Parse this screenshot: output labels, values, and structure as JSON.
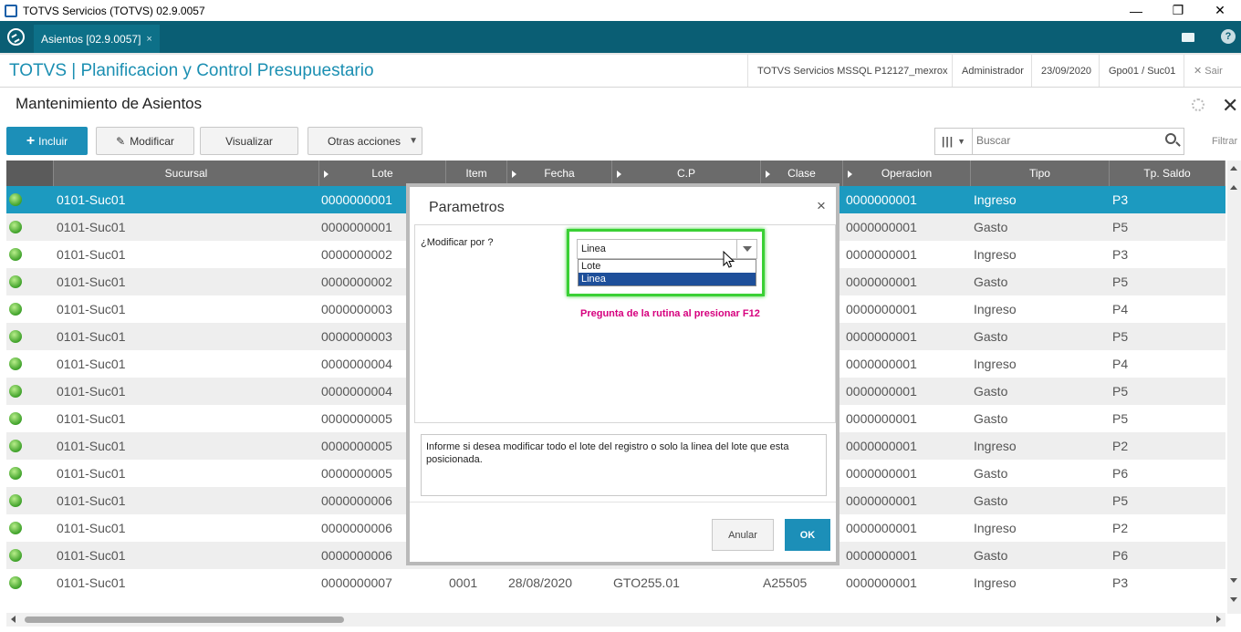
{
  "window": {
    "title": "TOTVS Servicios (TOTVS) 02.9.0057",
    "minimize": "—",
    "restore": "❐",
    "close": "✕"
  },
  "tabbar": {
    "tab_label": "Asientos [02.9.0057]",
    "tab_close": "×",
    "help": "?"
  },
  "header": {
    "module_title": "TOTVS | Planificacion y Control Presupuestario",
    "environment": "TOTVS Servicios MSSQL P12127_mexrox",
    "user": "Administrador",
    "date": "23/09/2020",
    "branch": "Gpo01 / Suc01",
    "exit": "✕  Sair"
  },
  "page": {
    "title": "Mantenimiento de Asientos",
    "close": "✕"
  },
  "toolbar": {
    "incluir": "Incluir",
    "modificar": "Modificar",
    "visualizar": "Visualizar",
    "otras_acciones": "Otras acciones",
    "search_placeholder": "Buscar",
    "filtrar": "Filtrar"
  },
  "grid": {
    "columns": [
      "Sucursal",
      "Lote",
      "Item",
      "Fecha",
      "C.P",
      "Clase",
      "Operacion",
      "Tipo",
      "Tp. Saldo"
    ],
    "rows": [
      {
        "sucursal": "0101-Suc01",
        "lote": "0000000001",
        "item": "",
        "fecha": "",
        "cp": "",
        "clase": "",
        "operacion": "0000000001",
        "tipo": "Ingreso",
        "tp_saldo": "P3"
      },
      {
        "sucursal": "0101-Suc01",
        "lote": "0000000001",
        "item": "",
        "fecha": "",
        "cp": "",
        "clase": "",
        "operacion": "0000000001",
        "tipo": "Gasto",
        "tp_saldo": "P5"
      },
      {
        "sucursal": "0101-Suc01",
        "lote": "0000000002",
        "item": "",
        "fecha": "",
        "cp": "",
        "clase": "",
        "operacion": "0000000001",
        "tipo": "Ingreso",
        "tp_saldo": "P3"
      },
      {
        "sucursal": "0101-Suc01",
        "lote": "0000000002",
        "item": "",
        "fecha": "",
        "cp": "",
        "clase": "",
        "operacion": "0000000001",
        "tipo": "Gasto",
        "tp_saldo": "P5"
      },
      {
        "sucursal": "0101-Suc01",
        "lote": "0000000003",
        "item": "",
        "fecha": "",
        "cp": "",
        "clase": "",
        "operacion": "0000000001",
        "tipo": "Ingreso",
        "tp_saldo": "P4"
      },
      {
        "sucursal": "0101-Suc01",
        "lote": "0000000003",
        "item": "",
        "fecha": "",
        "cp": "",
        "clase": "",
        "operacion": "0000000001",
        "tipo": "Gasto",
        "tp_saldo": "P5"
      },
      {
        "sucursal": "0101-Suc01",
        "lote": "0000000004",
        "item": "",
        "fecha": "",
        "cp": "",
        "clase": "",
        "operacion": "0000000001",
        "tipo": "Ingreso",
        "tp_saldo": "P4"
      },
      {
        "sucursal": "0101-Suc01",
        "lote": "0000000004",
        "item": "",
        "fecha": "",
        "cp": "",
        "clase": "",
        "operacion": "0000000001",
        "tipo": "Gasto",
        "tp_saldo": "P5"
      },
      {
        "sucursal": "0101-Suc01",
        "lote": "0000000005",
        "item": "",
        "fecha": "",
        "cp": "",
        "clase": "",
        "operacion": "0000000001",
        "tipo": "Gasto",
        "tp_saldo": "P5"
      },
      {
        "sucursal": "0101-Suc01",
        "lote": "0000000005",
        "item": "",
        "fecha": "",
        "cp": "",
        "clase": "",
        "operacion": "0000000001",
        "tipo": "Ingreso",
        "tp_saldo": "P2"
      },
      {
        "sucursal": "0101-Suc01",
        "lote": "0000000005",
        "item": "",
        "fecha": "",
        "cp": "",
        "clase": "",
        "operacion": "0000000001",
        "tipo": "Gasto",
        "tp_saldo": "P6"
      },
      {
        "sucursal": "0101-Suc01",
        "lote": "0000000006",
        "item": "",
        "fecha": "",
        "cp": "",
        "clase": "",
        "operacion": "0000000001",
        "tipo": "Gasto",
        "tp_saldo": "P5"
      },
      {
        "sucursal": "0101-Suc01",
        "lote": "0000000006",
        "item": "",
        "fecha": "",
        "cp": "",
        "clase": "",
        "operacion": "0000000001",
        "tipo": "Ingreso",
        "tp_saldo": "P2"
      },
      {
        "sucursal": "0101-Suc01",
        "lote": "0000000006",
        "item": "",
        "fecha": "",
        "cp": "",
        "clase": "",
        "operacion": "0000000001",
        "tipo": "Gasto",
        "tp_saldo": "P6"
      },
      {
        "sucursal": "0101-Suc01",
        "lote": "0000000007",
        "item": "0001",
        "fecha": "28/08/2020",
        "cp": "GTO255.01",
        "clase": "A25505",
        "operacion": "0000000001",
        "tipo": "Ingreso",
        "tp_saldo": "P3"
      }
    ]
  },
  "dialog": {
    "title": "Parametros",
    "close": "×",
    "question": "¿Modificar por ?",
    "selected": "Linea",
    "options": [
      "Lote",
      "Linea"
    ],
    "note": "Pregunta de la rutina al presionar F12",
    "help_text": "Informe si desea modificar todo el lote del registro o solo la linea del lote que esta posicionada.",
    "cancel": "Anular",
    "ok": "OK"
  },
  "colors": {
    "accent": "#1c8fb8",
    "tabbar": "#0a5e74",
    "highlight": "#3ad035",
    "note": "#d6007e"
  }
}
